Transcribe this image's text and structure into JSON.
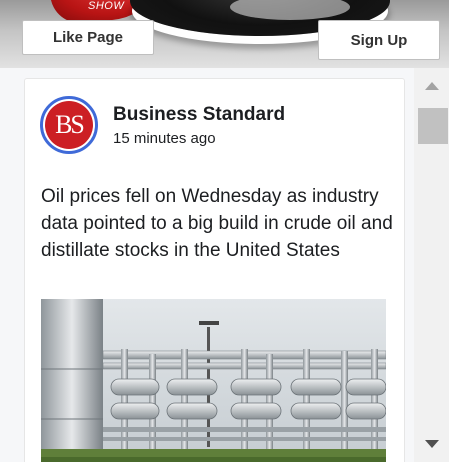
{
  "banner": {
    "show_text": "SHOW"
  },
  "header": {
    "like_label": "Like Page",
    "signup_label": "Sign Up"
  },
  "post": {
    "page_name": "Business Standard",
    "avatar_text": "BS",
    "timestamp": "15 minutes ago",
    "text": "Oil prices fell on Wednesday as industry data pointed to a big build in crude oil and distillate stocks in the United States"
  },
  "colors": {
    "brand_red": "#cc1f24",
    "avatar_ring": "#3f6ad8"
  },
  "icons": {
    "scroll_up": "triangle-up-icon",
    "scroll_down": "triangle-down-icon"
  }
}
